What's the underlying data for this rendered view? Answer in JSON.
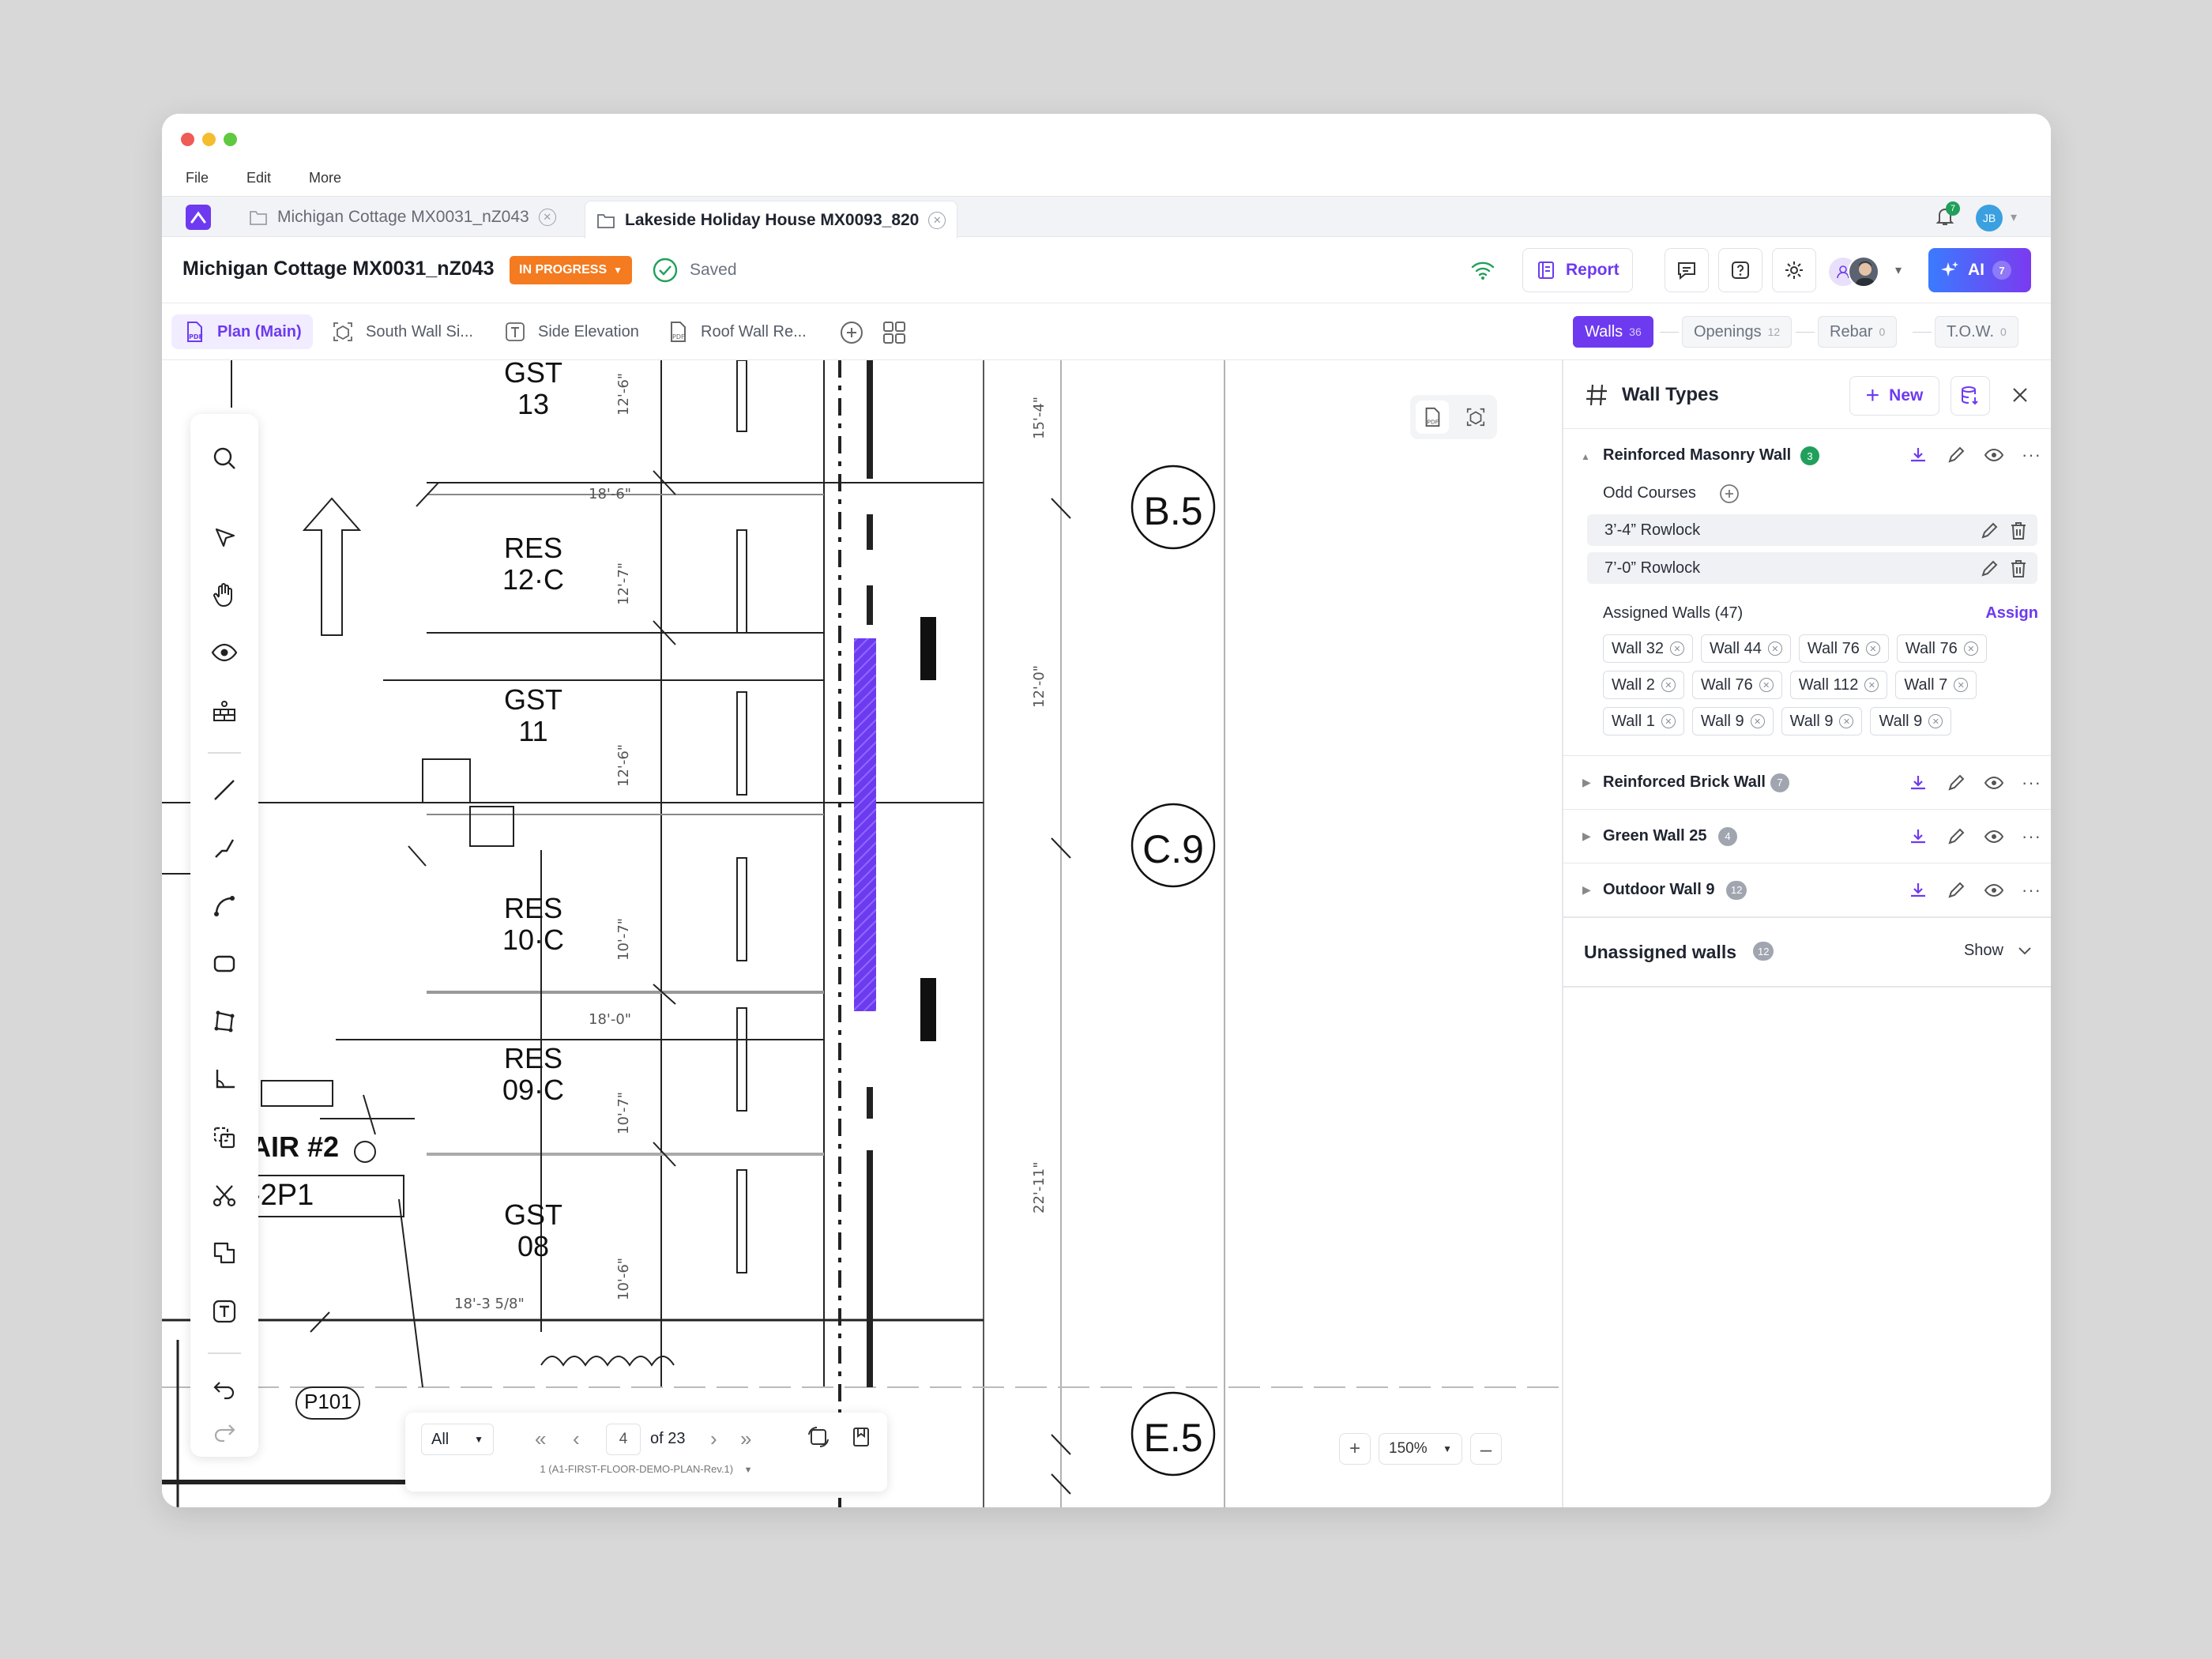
{
  "menu": {
    "file": "File",
    "edit": "Edit",
    "more": "More"
  },
  "tabs": [
    {
      "label": "Michigan Cottage MX0031_nZ043"
    },
    {
      "label": "Lakeside Holiday House MX0093_820"
    }
  ],
  "notifications": {
    "count": "7"
  },
  "user": {
    "initials": "JB"
  },
  "header": {
    "project_title": "Michigan Cottage MX0031_nZ043",
    "status": "IN PROGRESS",
    "saved_label": "Saved",
    "report_label": "Report",
    "ai_label": "AI",
    "ai_count": "7"
  },
  "subtabs": [
    {
      "label": "Plan (Main)"
    },
    {
      "label": "South Wall Si..."
    },
    {
      "label": "Side Elevation"
    },
    {
      "label": "Roof Wall Re..."
    }
  ],
  "filters": {
    "walls": {
      "label": "Walls",
      "count": "36"
    },
    "openings": {
      "label": "Openings",
      "count": "12"
    },
    "rebar": {
      "label": "Rebar",
      "count": "0"
    },
    "tow": {
      "label": "T.O.W.",
      "count": "0"
    }
  },
  "drawing": {
    "rooms": [
      {
        "name": "GST",
        "num": "13"
      },
      {
        "name": "RES",
        "num": "12·C"
      },
      {
        "name": "GST",
        "num": "11"
      },
      {
        "name": "RES",
        "num": "10·C"
      },
      {
        "name": "RES",
        "num": "09·C"
      },
      {
        "name": "GST",
        "num": "08"
      }
    ],
    "grid_labels": [
      "B.5",
      "C.9",
      "E.5"
    ],
    "stair_label": "AIR #2",
    "stair_sub": "-2P1",
    "door_tag": "P101"
  },
  "pager": {
    "filter": "All",
    "page": "4",
    "of": "of 23",
    "sheet": "1 (A1-FIRST-FLOOR-DEMO-PLAN-Rev.1)"
  },
  "zoom": {
    "value": "150%"
  },
  "panel": {
    "title": "Wall Types",
    "new_label": "New",
    "types": [
      {
        "name": "Reinforced Masonry Wall",
        "count": "3"
      },
      {
        "name": "Reinforced Brick Wall",
        "count": "7"
      },
      {
        "name": "Green Wall 25",
        "count": "4"
      },
      {
        "name": "Outdoor Wall 9",
        "count": "12"
      }
    ],
    "odd_courses_label": "Odd Courses",
    "courses": [
      "3’-4” Rowlock",
      "7’-0” Rowlock"
    ],
    "assigned_label": "Assigned Walls (47)",
    "assign_label": "Assign",
    "assigned_walls": [
      "Wall 32",
      "Wall 44",
      "Wall 76",
      "Wall 76",
      "Wall 2",
      "Wall 76",
      "Wall 112",
      "Wall 7",
      "Wall 1",
      "Wall 9",
      "Wall 9",
      "Wall 9"
    ],
    "unassigned_label": "Unassigned walls",
    "unassigned_count": "12",
    "show_label": "Show"
  },
  "colors": {
    "accent": "#6d3af0",
    "status": "#f47b20",
    "green": "#20a05a",
    "ai_gradient": "#3a7bff"
  }
}
